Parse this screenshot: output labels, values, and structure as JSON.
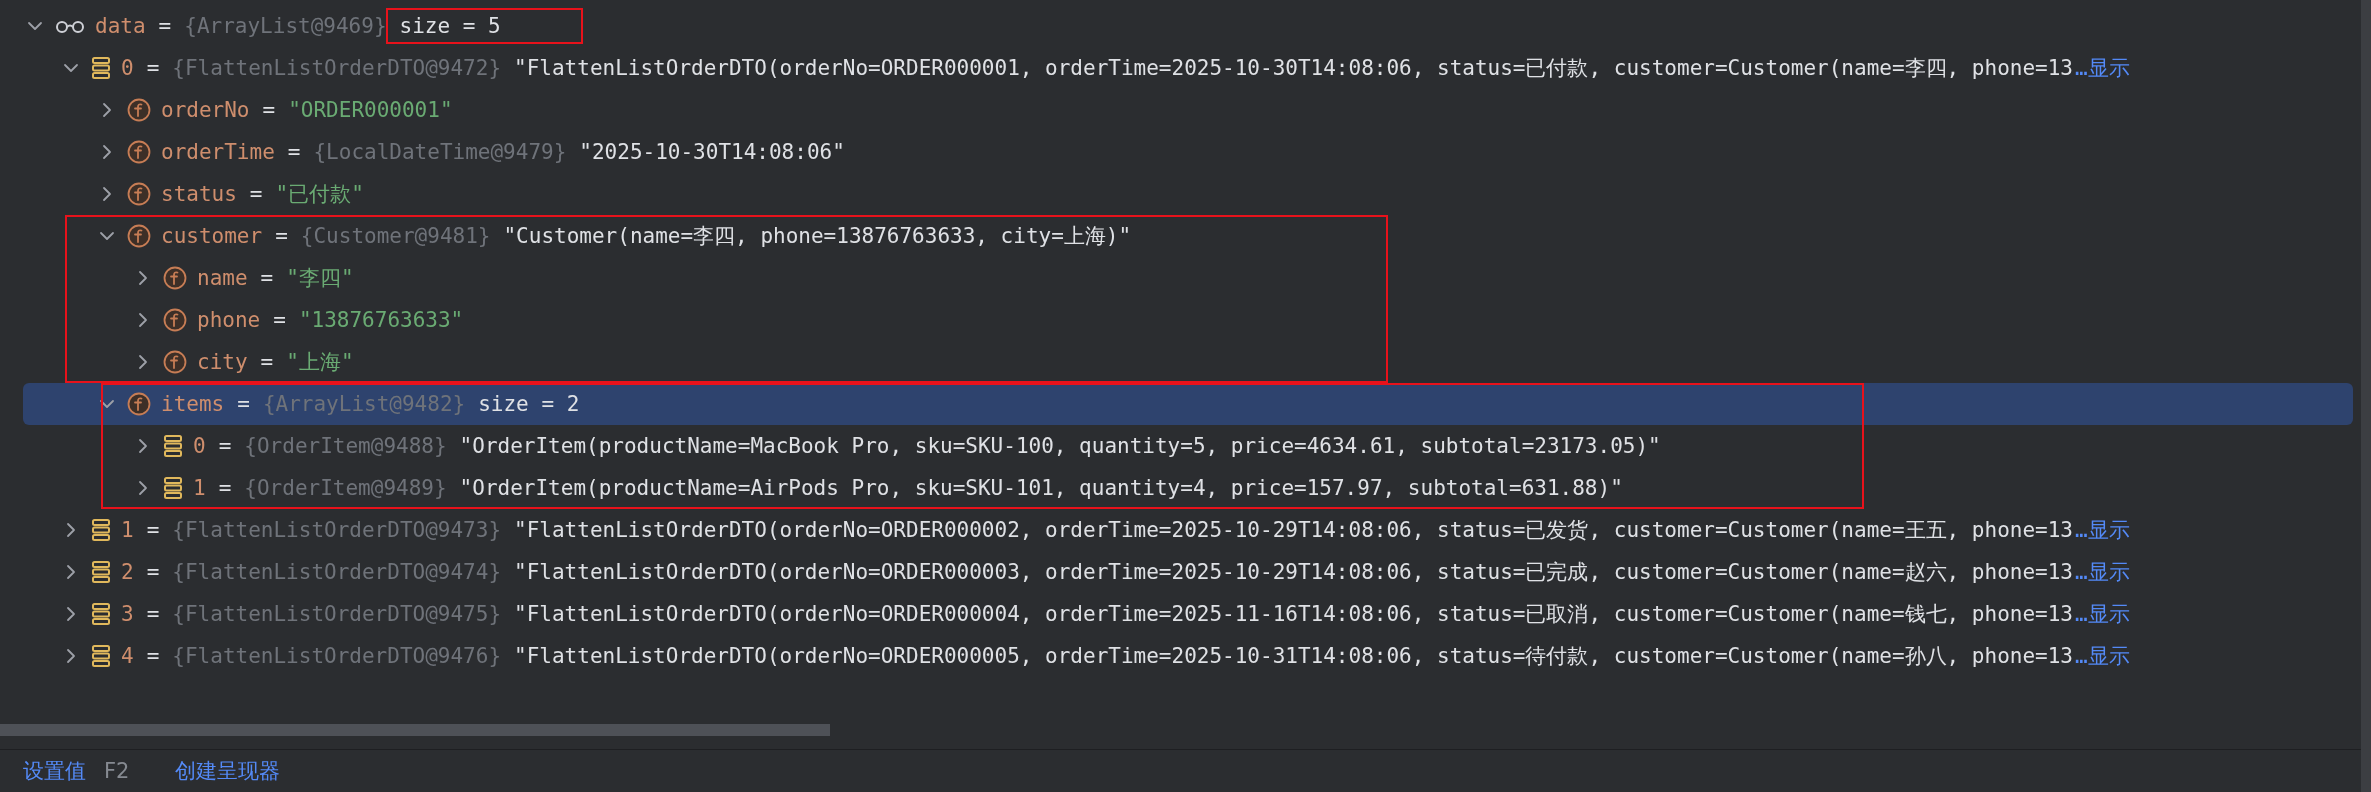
{
  "tree": [
    {
      "kind": "watch",
      "name": "data",
      "eq": "=",
      "type": "{ArrayList@9469}",
      "value": "size = 5",
      "is_string": false,
      "value_boxed": true,
      "group_boxed": false,
      "expanded": true,
      "selected": false,
      "children": [
        {
          "kind": "element",
          "name": "0",
          "eq": "=",
          "type": "{FlattenListOrderDTO@9472}",
          "value": "\"FlattenListOrderDTO(orderNo=ORDER000001, orderTime=2025-10-30T14:08:06, status=已付款, customer=Customer(name=李四, phone=13",
          "more": "…显示",
          "is_string": false,
          "value_boxed": false,
          "group_boxed": false,
          "expanded": true,
          "selected": false,
          "children": [
            {
              "kind": "field",
              "name": "orderNo",
              "eq": "=",
              "value": "\"ORDER000001\"",
              "is_string": true,
              "value_boxed": false,
              "group_boxed": false,
              "expanded": false,
              "selected": false
            },
            {
              "kind": "field",
              "name": "orderTime",
              "eq": "=",
              "type": "{LocalDateTime@9479}",
              "value": "\"2025-10-30T14:08:06\"",
              "is_string": false,
              "value_boxed": false,
              "group_boxed": false,
              "expanded": false,
              "selected": false
            },
            {
              "kind": "field",
              "name": "status",
              "eq": "=",
              "value": "\"已付款\"",
              "is_string": true,
              "value_boxed": false,
              "group_boxed": false,
              "expanded": false,
              "selected": false
            },
            {
              "kind": "field",
              "name": "customer",
              "eq": "=",
              "type": "{Customer@9481}",
              "value": "\"Customer(name=李四, phone=13876763633, city=上海)\"",
              "is_string": false,
              "value_boxed": false,
              "group_boxed": true,
              "expanded": true,
              "selected": false,
              "children": [
                {
                  "kind": "field",
                  "name": "name",
                  "eq": "=",
                  "value": "\"李四\"",
                  "is_string": true,
                  "value_boxed": false,
                  "group_boxed": false,
                  "expanded": false,
                  "selected": false
                },
                {
                  "kind": "field",
                  "name": "phone",
                  "eq": "=",
                  "value": "\"13876763633\"",
                  "is_string": true,
                  "value_boxed": false,
                  "group_boxed": false,
                  "expanded": false,
                  "selected": false
                },
                {
                  "kind": "field",
                  "name": "city",
                  "eq": "=",
                  "value": "\"上海\"",
                  "is_string": true,
                  "value_boxed": false,
                  "group_boxed": false,
                  "expanded": false,
                  "selected": false
                }
              ]
            },
            {
              "kind": "field",
              "name": "items",
              "eq": "=",
              "type": "{ArrayList@9482}",
              "value": "size = 2",
              "is_string": false,
              "value_boxed": false,
              "group_boxed": true,
              "expanded": true,
              "selected": true,
              "children": [
                {
                  "kind": "element",
                  "name": "0",
                  "eq": "=",
                  "type": "{OrderItem@9488}",
                  "value": "\"OrderItem(productName=MacBook Pro, sku=SKU-100, quantity=5, price=4634.61, subtotal=23173.05)\"",
                  "is_string": false,
                  "value_boxed": false,
                  "group_boxed": false,
                  "expanded": false,
                  "selected": false
                },
                {
                  "kind": "element",
                  "name": "1",
                  "eq": "=",
                  "type": "{OrderItem@9489}",
                  "value": "\"OrderItem(productName=AirPods Pro, sku=SKU-101, quantity=4, price=157.97, subtotal=631.88)\"",
                  "is_string": false,
                  "value_boxed": false,
                  "group_boxed": false,
                  "expanded": false,
                  "selected": false
                }
              ]
            }
          ]
        },
        {
          "kind": "element",
          "name": "1",
          "eq": "=",
          "type": "{FlattenListOrderDTO@9473}",
          "value": "\"FlattenListOrderDTO(orderNo=ORDER000002, orderTime=2025-10-29T14:08:06, status=已发货, customer=Customer(name=王五, phone=13",
          "more": "…显示",
          "is_string": false,
          "value_boxed": false,
          "group_boxed": false,
          "expanded": false,
          "selected": false
        },
        {
          "kind": "element",
          "name": "2",
          "eq": "=",
          "type": "{FlattenListOrderDTO@9474}",
          "value": "\"FlattenListOrderDTO(orderNo=ORDER000003, orderTime=2025-10-29T14:08:06, status=已完成, customer=Customer(name=赵六, phone=13",
          "more": "…显示",
          "is_string": false,
          "value_boxed": false,
          "group_boxed": false,
          "expanded": false,
          "selected": false
        },
        {
          "kind": "element",
          "name": "3",
          "eq": "=",
          "type": "{FlattenListOrderDTO@9475}",
          "value": "\"FlattenListOrderDTO(orderNo=ORDER000004, orderTime=2025-11-16T14:08:06, status=已取消, customer=Customer(name=钱七, phone=13",
          "more": "…显示",
          "is_string": false,
          "value_boxed": false,
          "group_boxed": false,
          "expanded": false,
          "selected": false
        },
        {
          "kind": "element",
          "name": "4",
          "eq": "=",
          "type": "{FlattenListOrderDTO@9476}",
          "value": "\"FlattenListOrderDTO(orderNo=ORDER000005, orderTime=2025-10-31T14:08:06, status=待付款, customer=Customer(name=孙八, phone=13",
          "more": "…显示",
          "is_string": false,
          "value_boxed": false,
          "group_boxed": false,
          "expanded": false,
          "selected": false
        }
      ]
    }
  ],
  "actions": [
    {
      "label": "设置值",
      "shortcut": "F2"
    },
    {
      "label": "创建呈现器"
    }
  ]
}
